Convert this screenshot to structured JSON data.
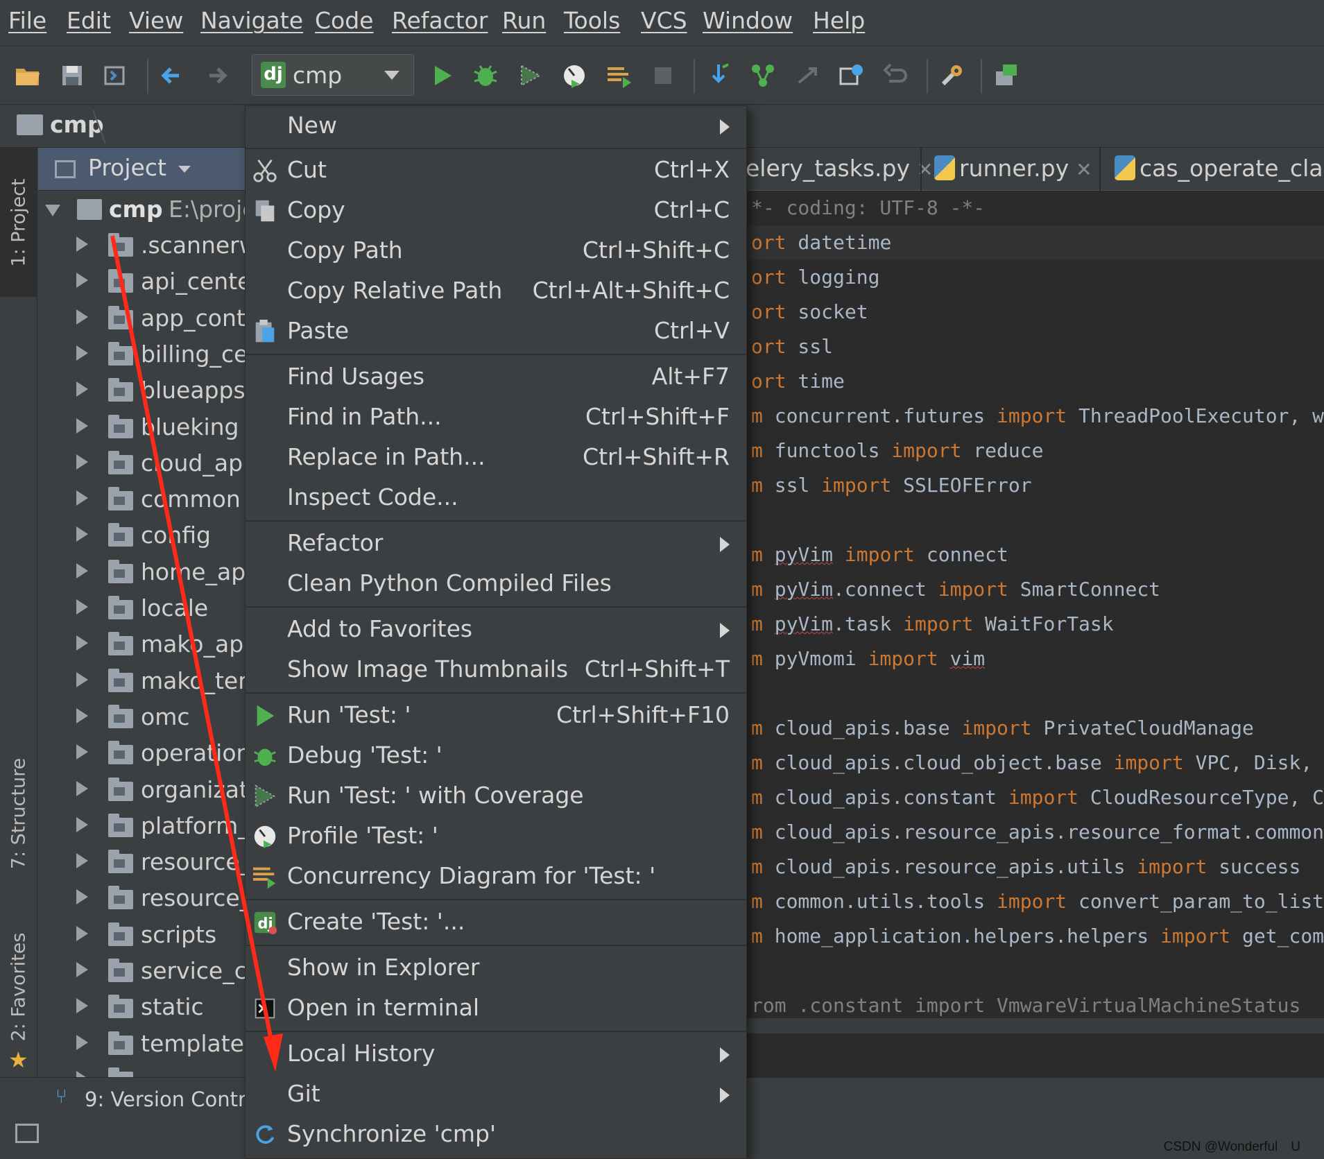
{
  "menubar": [
    "File",
    "Edit",
    "View",
    "Navigate",
    "Code",
    "Refactor",
    "Run",
    "Tools",
    "VCS",
    "Window",
    "Help"
  ],
  "toolbar": {
    "run_config": "cmp",
    "run_config_icon": "dj"
  },
  "navbar": {
    "crumb": "cmp"
  },
  "left_strip": {
    "project_tab": "1: Project",
    "structure_tab": "7: Structure",
    "favorites_tab": "2: Favorites"
  },
  "project_panel": {
    "header": "Project",
    "root": {
      "name": "cmp",
      "path": "E:\\proje"
    },
    "items": [
      ".scannerw",
      "api_center",
      "app_contr",
      "billing_cer",
      "blueapps",
      "blueking",
      "cloud_apis",
      "common",
      "config",
      "home_app",
      "locale",
      "mako_app",
      "mako_tem",
      "omc",
      "operation",
      "organizati",
      "platform_i",
      "resource_",
      "resource_",
      "scripts",
      "service_ce",
      "static",
      "templates",
      "..."
    ]
  },
  "editor": {
    "tabs": [
      "elery_tasks.py",
      "runner.py",
      "cas_operate_clas"
    ],
    "code": [
      "*- coding: UTF-8 -*-",
      "ort datetime",
      "ort logging",
      "ort socket",
      "ort ssl",
      "ort time",
      "m concurrent.futures import ThreadPoolExecutor, wait",
      "m functools import reduce",
      "m ssl import SSLEOFError",
      "",
      "m pyVim import connect",
      "m pyVim.connect import SmartConnect",
      "m pyVim.task import WaitForTask",
      "m pyVmomi import vim",
      "",
      "m cloud_apis.base import PrivateCloudManage",
      "m cloud_apis.cloud_object.base import VPC, Disk, Ima",
      "m cloud_apis.constant import CloudResourceType, Clou",
      "m cloud_apis.resource_apis.resource_format.common.ba",
      "m cloud_apis.resource_apis.utils import success",
      "m common.utils.tools import convert_param_to_list, t",
      "m home_application.helpers.helpers import get_comput",
      "",
      "rom .constant import VmwareVirtualMachineStatus"
    ]
  },
  "bottom": {
    "version_control": "9: Version Contro"
  },
  "context_menu": {
    "new": "New",
    "cut": "Cut",
    "cut_sc": "Ctrl+X",
    "copy": "Copy",
    "copy_sc": "Ctrl+C",
    "copy_path": "Copy Path",
    "copy_path_sc": "Ctrl+Shift+C",
    "copy_rel": "Copy Relative Path",
    "copy_rel_sc": "Ctrl+Alt+Shift+C",
    "paste": "Paste",
    "paste_sc": "Ctrl+V",
    "find_usages": "Find Usages",
    "find_usages_sc": "Alt+F7",
    "find_in_path": "Find in Path...",
    "find_in_path_sc": "Ctrl+Shift+F",
    "replace_in_path": "Replace in Path...",
    "replace_in_path_sc": "Ctrl+Shift+R",
    "inspect": "Inspect Code...",
    "refactor": "Refactor",
    "clean": "Clean Python Compiled Files",
    "favorites": "Add to Favorites",
    "thumbs": "Show Image Thumbnails",
    "thumbs_sc": "Ctrl+Shift+T",
    "run": "Run 'Test: '",
    "run_sc": "Ctrl+Shift+F10",
    "debug": "Debug 'Test: '",
    "coverage": "Run 'Test: ' with Coverage",
    "profile": "Profile 'Test: '",
    "concurrency": "Concurrency Diagram for 'Test: '",
    "create": "Create 'Test: '...",
    "explorer": "Show in Explorer",
    "terminal": "Open in terminal",
    "local_history": "Local History",
    "git": "Git",
    "sync": "Synchronize 'cmp'"
  },
  "watermark": "CSDN @Wonderful　U",
  "colors": {
    "accent_red": "#ff2a1a",
    "run_green": "#4fb04f",
    "keyword": "#cc7832"
  }
}
